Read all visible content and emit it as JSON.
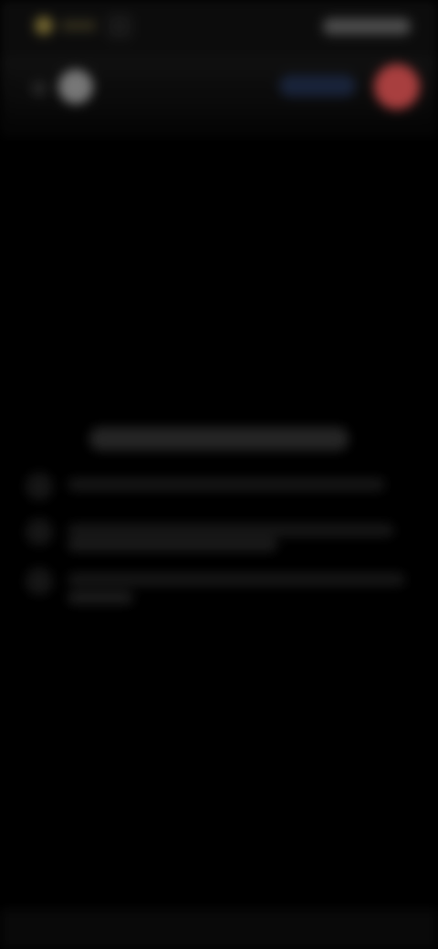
{
  "screen": {
    "background": "#000000",
    "state": "blurred-overlay"
  },
  "status_bar": {
    "icons": [
      "app-indicator-icon",
      "battery-icon"
    ]
  },
  "controls": {
    "mic_icon": "microphone-icon",
    "end_call_icon": "end-call-icon",
    "end_call_color": "#c64a4a"
  },
  "card": {
    "step_count": 3
  }
}
